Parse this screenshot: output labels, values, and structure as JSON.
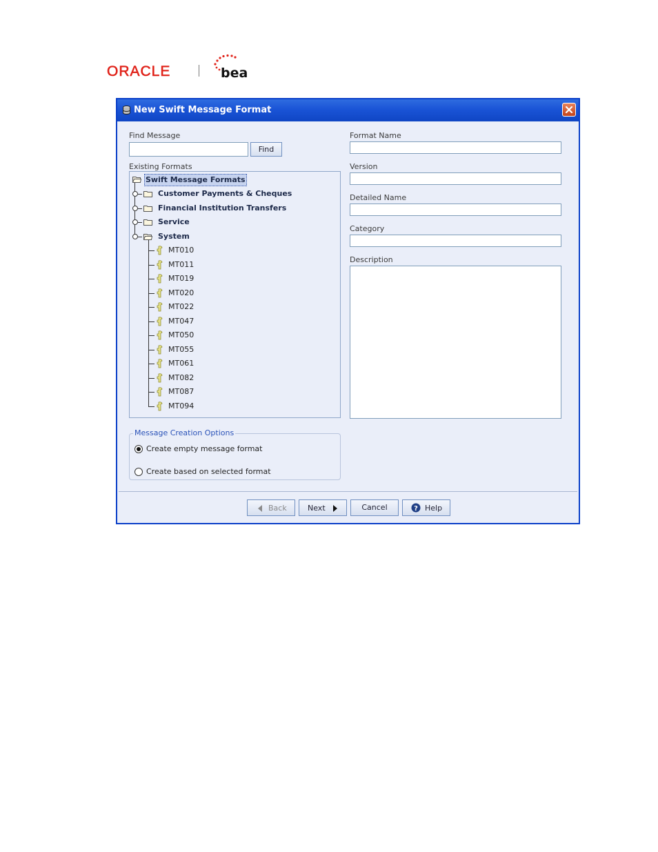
{
  "header": {
    "oracle_logo": "ORACLE",
    "bea_logo": "bea"
  },
  "dialog": {
    "title": "New Swift Message Format",
    "find": {
      "label": "Find Message",
      "value": "",
      "button": "Find"
    },
    "existing_label": "Existing Formats",
    "tree": {
      "root": "Swift Message Formats",
      "folders": [
        "Customer Payments & Cheques",
        "Financial Institution Transfers",
        "Service",
        "System"
      ],
      "system_items": [
        "MT010",
        "MT011",
        "MT019",
        "MT020",
        "MT022",
        "MT047",
        "MT050",
        "MT055",
        "MT061",
        "MT082",
        "MT087",
        "MT094"
      ]
    },
    "fields": {
      "format_name": {
        "label": "Format Name",
        "value": ""
      },
      "version": {
        "label": "Version",
        "value": ""
      },
      "detailed_name": {
        "label": "Detailed Name",
        "value": ""
      },
      "category": {
        "label": "Category",
        "value": ""
      },
      "description": {
        "label": "Description",
        "value": ""
      }
    },
    "options": {
      "legend": "Message Creation Options",
      "empty": "Create empty message format",
      "based": "Create based on selected format",
      "selected": "empty"
    },
    "buttons": {
      "back": "Back",
      "next": "Next",
      "cancel": "Cancel",
      "help": "Help"
    },
    "colors": {
      "title_bar": "#1a54d6",
      "dialog_bg": "#eaeef9",
      "legend": "#2a52b8"
    }
  }
}
